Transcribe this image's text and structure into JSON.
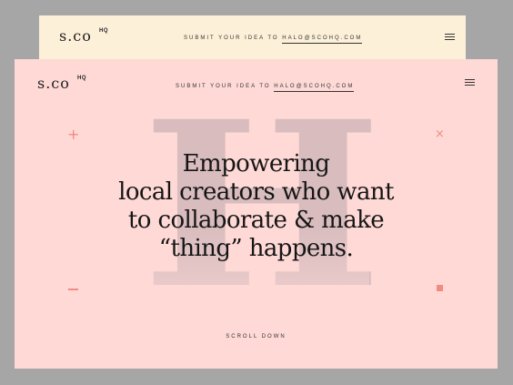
{
  "back_card": {
    "logo": "s.co",
    "logo_sup": "HQ",
    "nav_prefix": "SUBMIT YOUR IDEA TO",
    "nav_email": "HALO@SCOHQ.COM"
  },
  "front_card": {
    "logo": "s.co",
    "logo_sup": "HQ",
    "nav_prefix": "SUBMIT YOUR IDEA TO",
    "nav_email": "HALO@SCOHQ.COM",
    "big_letter": "H",
    "headline": [
      "Empowering",
      "local creators who want",
      "to collaborate & make",
      "“thing” happens."
    ],
    "scroll_label": "SCROLL DOWN"
  },
  "icons": {
    "menu": "hamburger-menu-icon",
    "plus": "plus-icon",
    "close": "x-icon",
    "minus": "minus-icon",
    "square": "square-icon"
  },
  "colors": {
    "background": "#a6a6a6",
    "back_card": "#fdf0d8",
    "front_card": "#fed9d6",
    "accent": "#f28c82",
    "big_letter": "#d8bcbe",
    "text": "#161616"
  },
  "deco": {
    "plus": "+",
    "x": "×"
  }
}
